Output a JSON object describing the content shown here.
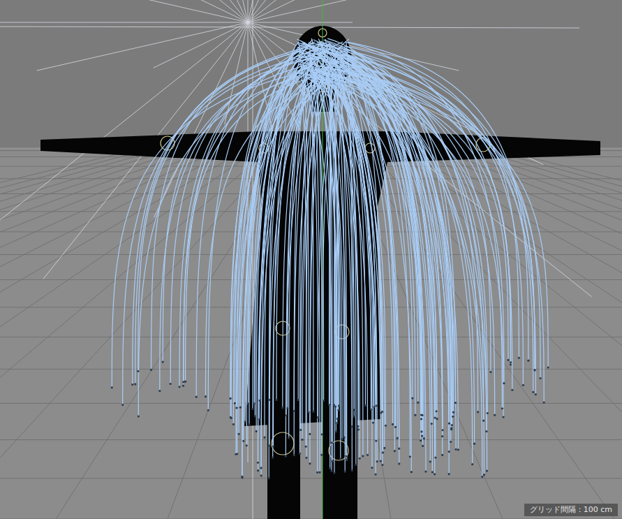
{
  "viewport": {
    "grid_spacing_label": "グリッド間隔：100 cm"
  }
}
